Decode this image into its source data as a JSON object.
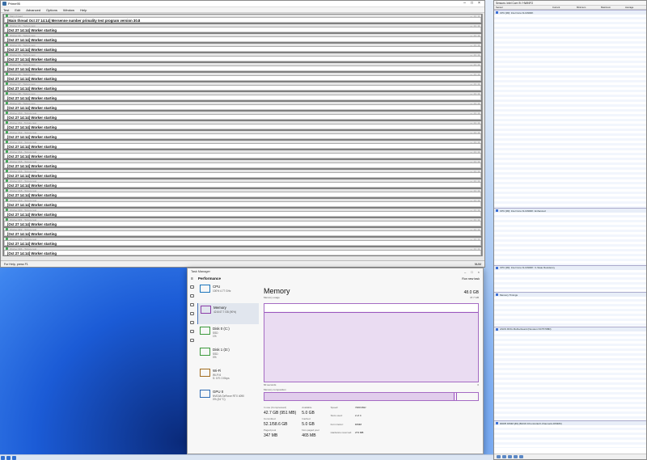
{
  "prime": {
    "title": "Prime95",
    "menu": [
      "Test",
      "Edit",
      "Advanced",
      "Options",
      "Window",
      "Help"
    ],
    "children": [
      {
        "title": "Main thread",
        "text": "[Main thread Oct 27 14:14] Mersenne number primality test program version 30.8"
      },
      {
        "title": "Worker #1 - Torture test",
        "text": "[Oct 27 14:14] Worker starting"
      },
      {
        "title": "Worker #2 - Torture test",
        "text": "[Oct 27 14:14] Worker starting"
      },
      {
        "title": "Worker #3 - Torture test",
        "text": "[Oct 27 14:14] Worker starting"
      },
      {
        "title": "Worker #4 - Torture test",
        "text": "[Oct 27 14:14] Worker starting"
      },
      {
        "title": "Worker #5 - Torture test",
        "text": "[Oct 27 14:14] Worker starting"
      },
      {
        "title": "Worker #6 - Torture test",
        "text": "[Oct 27 14:14] Worker starting"
      },
      {
        "title": "Worker #7 - Torture test",
        "text": "[Oct 27 14:14] Worker starting"
      },
      {
        "title": "Worker #8 - Torture test",
        "text": "[Oct 27 14:14] Worker starting"
      },
      {
        "title": "Worker #9 - Torture test",
        "text": "[Oct 27 14:14] Worker starting"
      },
      {
        "title": "Worker #10 - Torture test",
        "text": "[Oct 27 14:14] Worker starting"
      },
      {
        "title": "Worker #11 - Torture test",
        "text": "[Oct 27 14:14] Worker starting"
      },
      {
        "title": "Worker #12 - Torture test",
        "text": "[Oct 27 14:14] Worker starting"
      },
      {
        "title": "Worker #13 - Torture test",
        "text": "[Oct 27 14:14] Worker starting"
      },
      {
        "title": "Worker #14 - Torture test",
        "text": "[Oct 27 14:14] Worker starting"
      },
      {
        "title": "Worker #15 - Torture test",
        "text": "[Oct 27 14:14] Worker starting"
      },
      {
        "title": "Worker #16 - Torture test",
        "text": "[Oct 27 14:14] Worker starting"
      },
      {
        "title": "Worker #17 - Torture test",
        "text": "[Oct 27 14:14] Worker starting"
      },
      {
        "title": "Worker #18 - Torture test",
        "text": "[Oct 27 14:14] Worker starting"
      },
      {
        "title": "Worker #19 - Torture test",
        "text": "[Oct 27 14:14] Worker starting"
      },
      {
        "title": "Worker #20 - Torture test",
        "text": "[Oct 27 14:14] Worker starting"
      },
      {
        "title": "Worker #21 - Torture test",
        "text": "[Oct 27 14:14] Worker starting"
      },
      {
        "title": "Worker #22 - Torture test",
        "text": "[Oct 27 14:14] Worker starting"
      },
      {
        "title": "Worker #23 - Torture test",
        "text": "[Oct 27 14:14] Worker starting"
      },
      {
        "title": "Worker #24 - Torture test",
        "text": "[Oct 27 14:14] Worker starting"
      }
    ],
    "status_left": "For Help, press F1",
    "status_right": "NUM"
  },
  "hwinfo": {
    "title": "Sensors: Intel Core i9 / HWiNFO",
    "columns": [
      "Sensor",
      "Current",
      "Minimum",
      "Maximum",
      "Average"
    ],
    "groups": [
      {
        "name": "CPU [#0]: Intel Core i9-13900K",
        "rows": 52
      },
      {
        "name": "CPU [#0]: Intel Core i9-13900K: Enhanced",
        "rows": 14
      },
      {
        "name": "CPU [#0]: Intel Core i9-13900K: C-State Residency",
        "rows": 6
      },
      {
        "name": "Memory Timings",
        "rows": 8
      },
      {
        "name": "ASUS ROG Motherboard (Nuvoton NCT6798D)",
        "rows": 24
      },
      {
        "name": "DDR5 DIMM [#0] (BANK 0/Controller0-ChannelA-DIMM0)",
        "rows": 6
      }
    ]
  },
  "taskmgr": {
    "title": "Task Manager",
    "section": "Performance",
    "run_task": "Run new task",
    "tiles": [
      {
        "name": "CPU",
        "sub": "100% 4.77 GHz",
        "kind": "cpu",
        "active": false
      },
      {
        "name": "Memory",
        "sub": "42.6/47.7 GB (90%)",
        "kind": "mem",
        "active": true
      },
      {
        "name": "Disk 0 (C:)",
        "sub": "SSD\n1%",
        "kind": "disk",
        "active": false
      },
      {
        "name": "Disk 1 (D:)",
        "sub": "SSD\n0%",
        "kind": "disk",
        "active": false
      },
      {
        "name": "Wi-Fi",
        "sub": "Wi-Fi 6\nS: 0 R: 0 Kbps",
        "kind": "net",
        "active": false
      },
      {
        "name": "GPU 0",
        "sub": "NVIDIA GeForce RTX 4090\n0% (34 °C)",
        "kind": "gpu",
        "active": false
      }
    ],
    "memory": {
      "heading": "Memory",
      "total": "48.0 GB",
      "usage_label": "Memory usage",
      "usage_max": "47.7 GB",
      "usage_fraction": 0.9,
      "axis_left": "60 seconds",
      "axis_right": "0",
      "composition_label": "Memory composition",
      "in_use_label": "In use (Compressed)",
      "in_use": "42.7 GB (951 MB)",
      "available_label": "Available",
      "available": "5.0 GB",
      "committed_label": "Committed",
      "committed": "52.1/58.6 GB",
      "cached_label": "Cached",
      "cached": "5.0 GB",
      "paged_label": "Paged pool",
      "paged": "347 MB",
      "nonpaged_label": "Non-paged pool",
      "nonpaged": "465 MB",
      "speed_label": "Speed:",
      "speed": "7200 MHz",
      "slots_label": "Slots used:",
      "slots": "2 of 4",
      "form_label": "Form factor:",
      "form": "DIMM",
      "hw_label": "Hardware reserved:",
      "hw": "273 MB"
    }
  }
}
